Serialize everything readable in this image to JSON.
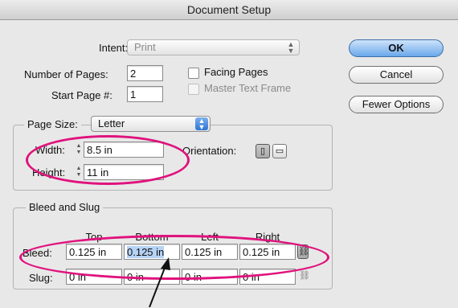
{
  "window": {
    "title": "Document Setup"
  },
  "intent": {
    "label": "Intent:",
    "value": "Print"
  },
  "pages": {
    "count_label": "Number of Pages:",
    "count_value": "2",
    "start_label": "Start Page #:",
    "start_value": "1",
    "facing_label": "Facing Pages",
    "master_label": "Master Text Frame"
  },
  "buttons": {
    "ok": "OK",
    "cancel": "Cancel",
    "fewer": "Fewer Options"
  },
  "page_size": {
    "label": "Page Size:",
    "value": "Letter",
    "width_label": "Width:",
    "width_value": "8.5 in",
    "height_label": "Height:",
    "height_value": "11 in",
    "orientation_label": "Orientation:"
  },
  "bleed_slug": {
    "title": "Bleed and Slug",
    "columns": [
      "Top",
      "Bottom",
      "Left",
      "Right"
    ],
    "bleed_label": "Bleed:",
    "bleed_values": [
      "0.125 in",
      "0.125 in",
      "0.125 in",
      "0.125 in"
    ],
    "slug_label": "Slug:",
    "slug_values": [
      "0 in",
      "0 in",
      "0 in",
      "0 in"
    ]
  },
  "icons": {
    "orientation_portrait": "portrait-icon",
    "orientation_landscape": "landscape-icon",
    "link_bleed": "chain-link-icon",
    "link_slug": "chain-link-icon"
  },
  "colors": {
    "highlight_ellipse": "#e0127d",
    "default_button": "#6aa7ea"
  }
}
